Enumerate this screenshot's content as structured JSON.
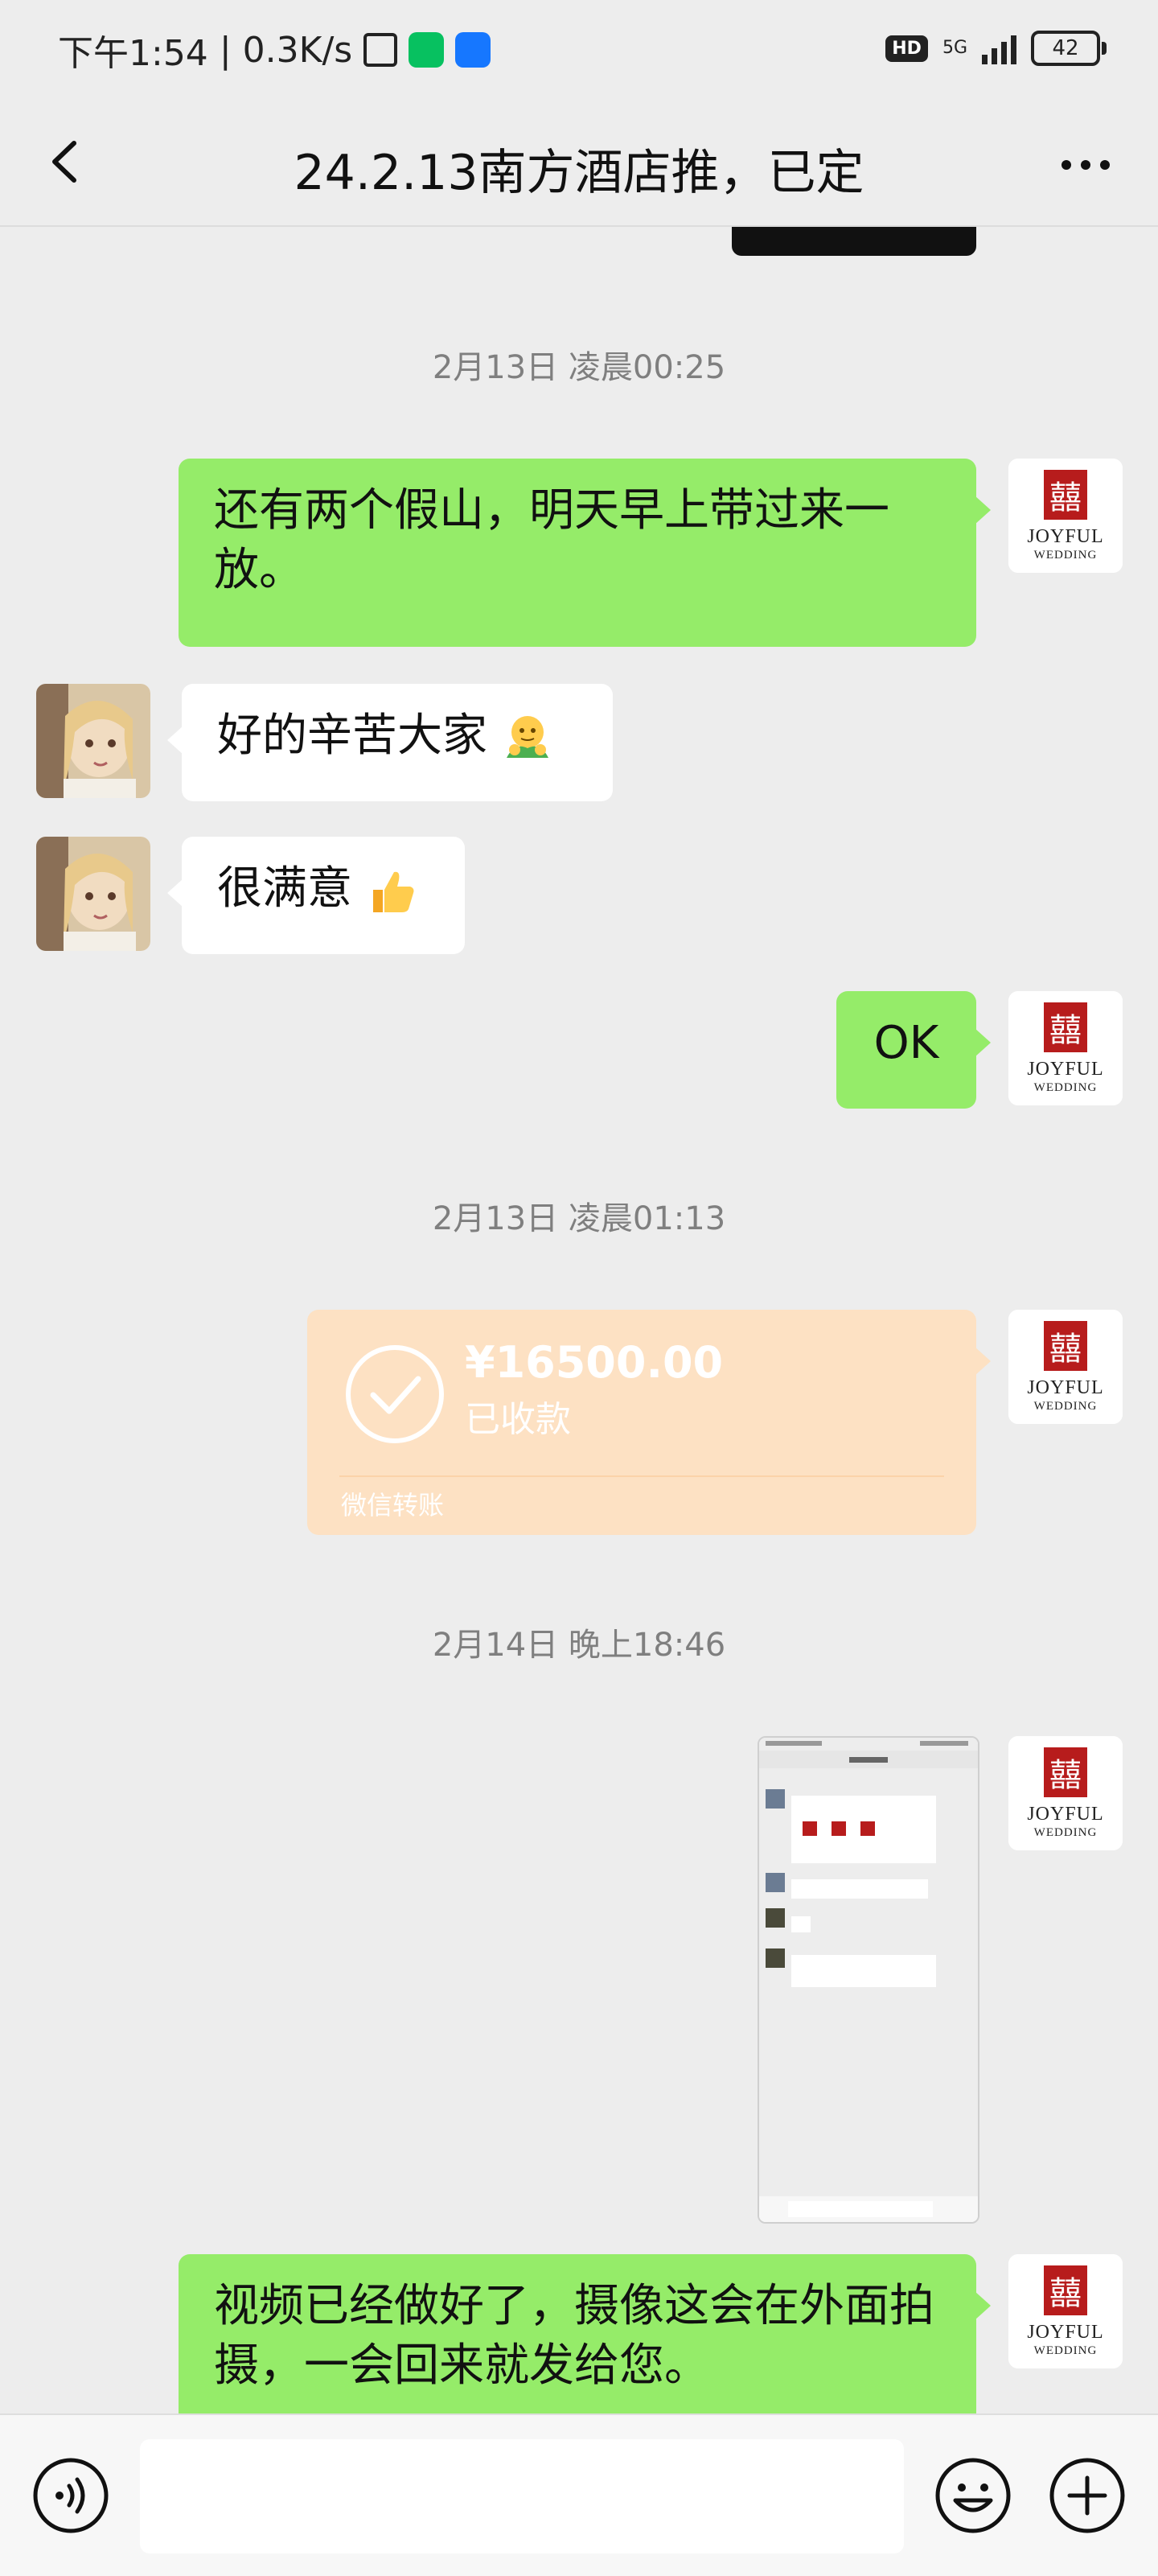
{
  "status_bar": {
    "time": "下午1:54",
    "speed": "0.3K/s",
    "hd": "HD",
    "network": "5G",
    "battery": "42"
  },
  "header": {
    "title": "24.2.13南方酒店推，已定"
  },
  "avatar_logo": {
    "name": "JOYFUL",
    "sub": "WEDDING",
    "brand_color": "#b71c1c"
  },
  "messages": {
    "ts1": "2月13日 凌晨00:25",
    "m1": "还有两个假山，明天早上带过来一放。",
    "m2": "好的辛苦大家",
    "m3": "很满意",
    "m4": "OK",
    "ts2": "2月13日 凌晨01:13",
    "ts3": "2月14日 晚上18:46",
    "m6": "视频已经做好了，摄像这会在外面拍摄，一会回来就发给您。"
  },
  "transfer": {
    "amount": "¥16500.00",
    "status": "已收款",
    "footer": "微信转账"
  },
  "colors": {
    "background": "#ededed",
    "green_bubble": "#95ec69",
    "transfer_bg": "#fde1c3"
  }
}
